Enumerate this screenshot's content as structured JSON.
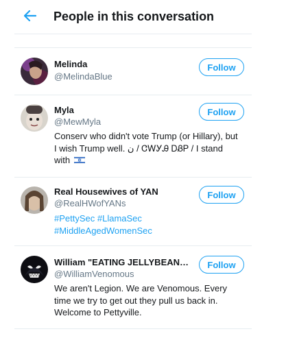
{
  "header": {
    "title": "People in this conversation",
    "back_icon": "arrow-left-icon"
  },
  "accent_color": "#1da1f2",
  "users": [
    {
      "name": "Melinda",
      "handle": "@MelindaBlue",
      "follow_label": "Follow"
    },
    {
      "name": "Myla",
      "handle": "@MewMyla",
      "follow_label": "Follow",
      "bio_lines": [
        "Conserv who didn't vote Trump (or Hillary), but",
        "I wish Trump well. ن / ᏣᎳᎩᎯ ᎠᏰᏢ / I stand",
        "with"
      ],
      "bio_flag": "israel-flag-icon"
    },
    {
      "name": "Real Housewives of YAN",
      "handle": "@RealHWofYANs",
      "follow_label": "Follow",
      "bio_tags_line1": "#PettySec #LlamaSec",
      "bio_tags_line2": "#MiddleAgedWomenSec"
    },
    {
      "name": "William \"EATING JELLYBEANS\" ...",
      "handle": "@WilliamVenomous",
      "follow_label": "Follow",
      "bio_lines": [
        "We aren't Legion. We are Venomous. Every",
        "time we try to get out they pull us back in.",
        "Welcome to Pettyville."
      ]
    }
  ]
}
